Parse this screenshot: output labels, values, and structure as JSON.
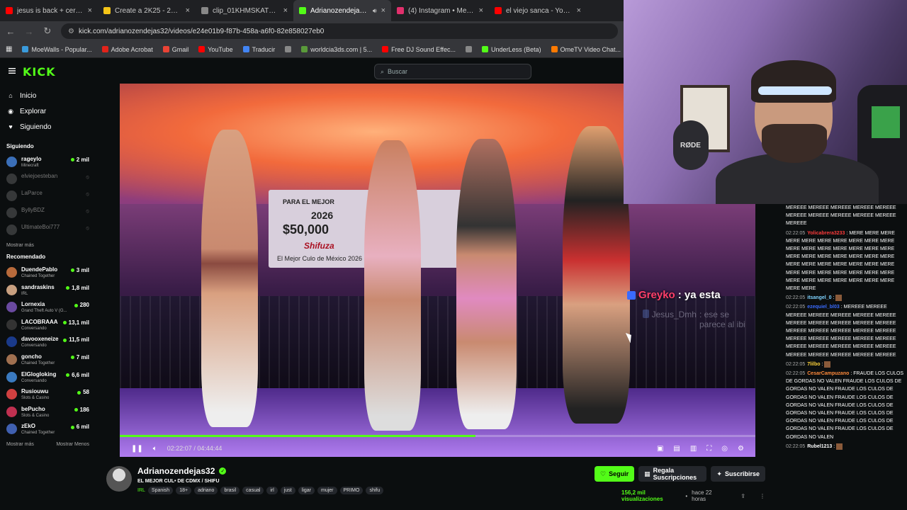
{
  "browser": {
    "tabs": [
      {
        "title": "jesus is back + cero - You",
        "color": "#ff0000",
        "active": false
      },
      {
        "title": "Create a 2K25 - 2K26 UD",
        "color": "#f5c518",
        "active": false
      },
      {
        "title": "clip_01KHMSKATMVBRN",
        "color": "#888888",
        "active": false
      },
      {
        "title": "Adrianozendejas32 - ",
        "color": "#53fc18",
        "active": true
      },
      {
        "title": "(4) Instagram • Mensajes",
        "color": "#e1306c",
        "active": false
      },
      {
        "title": "el viejo sanca - YouTube",
        "color": "#ff0000",
        "active": false
      }
    ],
    "url": "kick.com/adrianozendejas32/videos/e24e01b9-f87b-458a-a6f0-82e858027eb0",
    "bookmarks": [
      {
        "label": "MoeWalls - Popular...",
        "color": "#3a9bdc"
      },
      {
        "label": "Adobe Acrobat",
        "color": "#e2231a"
      },
      {
        "label": "Gmail",
        "color": "#ea4335"
      },
      {
        "label": "YouTube",
        "color": "#ff0000"
      },
      {
        "label": "Traducir",
        "color": "#4285f4"
      },
      {
        "label": "",
        "color": "#888888"
      },
      {
        "label": "worldcia3ds.com | 5...",
        "color": "#5a9a3a"
      },
      {
        "label": "Free DJ Sound Effec...",
        "color": "#ff0000"
      },
      {
        "label": "",
        "color": "#888888"
      },
      {
        "label": "UnderLess (Beta)",
        "color": "#53fc18"
      },
      {
        "label": "OmeTV Video Chat...",
        "color": "#ff7a00"
      }
    ]
  },
  "kick": {
    "logo": "KICK",
    "search_placeholder": "Buscar",
    "nav": [
      {
        "label": "Inicio",
        "icon": "home-icon",
        "glyph": "⌂"
      },
      {
        "label": "Explorar",
        "icon": "compass-icon",
        "glyph": "◉"
      },
      {
        "label": "Siguiendo",
        "icon": "heart-icon",
        "glyph": "♥"
      }
    ],
    "following_header": "Siguiendo",
    "following": [
      {
        "name": "rageylo",
        "category": "Minecraft",
        "viewers": "2 mil",
        "online": true,
        "color": "#3b6fb8"
      },
      {
        "name": "elviejoesteban",
        "category": "",
        "viewers": "",
        "online": false,
        "color": "#777777"
      },
      {
        "name": "LaParce",
        "category": "",
        "viewers": "",
        "online": false,
        "color": "#777777"
      },
      {
        "name": "ByllyBDZ",
        "category": "",
        "viewers": "",
        "online": false,
        "color": "#777777"
      },
      {
        "name": "UltimateBoi777",
        "category": "",
        "viewers": "",
        "online": false,
        "color": "#777777"
      }
    ],
    "show_more": "Mostrar más",
    "recommended_header": "Recomendado",
    "recommended": [
      {
        "name": "DuendePablo",
        "category": "Chained Together",
        "viewers": "3 mil",
        "color": "#b86a3b"
      },
      {
        "name": "sandraskins",
        "category": "IRL",
        "viewers": "1,8 mil",
        "color": "#c8a080"
      },
      {
        "name": "Lornexia",
        "category": "Grand Theft Auto V (G...",
        "viewers": "280",
        "color": "#6a4aa0"
      },
      {
        "name": "LACOBRAAA",
        "category": "Conversando",
        "viewers": "13,1 mil",
        "color": "#333333"
      },
      {
        "name": "davooxeneize",
        "category": "Conversando",
        "viewers": "11,5 mil",
        "color": "#1a3a8a"
      },
      {
        "name": "goncho",
        "category": "Chained Together",
        "viewers": "7 mil",
        "color": "#a07050"
      },
      {
        "name": "ElGlogloking",
        "category": "Conversando",
        "viewers": "6,6 mil",
        "color": "#3a7ac0"
      },
      {
        "name": "Rusiouwu",
        "category": "Slots & Casino",
        "viewers": "58",
        "color": "#d04040"
      },
      {
        "name": "bePucho",
        "category": "Slots & Casino",
        "viewers": "186",
        "color": "#c03050"
      },
      {
        "name": "zEkO",
        "category": "Chained Together",
        "viewers": "6 mil",
        "color": "#4060b0"
      }
    ],
    "footer_more": "Mostrar más",
    "footer_less": "Mostrar Menos"
  },
  "video": {
    "banner": {
      "line1": "PARA EL MEJOR",
      "line2": "2026",
      "line3": "$50,000",
      "line4": "Shifuza",
      "line5": "El Mejor Culo de México 2026"
    },
    "overlay_chat": [
      {
        "user": "Greyko",
        "text": ": ya esta"
      },
      {
        "user": "Jesus_Dmh",
        "text": ": ese se parece al ibi"
      }
    ],
    "time_current": "02:22:07",
    "time_sep": " / ",
    "time_total": "04:44:44",
    "progress_fraction": 0.56
  },
  "channel": {
    "name": "Adrianozendejas32",
    "title": "EL MEJOR CUL• DE CDMX  / SHIFU",
    "category": "IRL",
    "tags": [
      "Spanish",
      "18+",
      "adriano",
      "brasil",
      "casual",
      "irl",
      "just",
      "ligar",
      "mujer",
      "PRIMO",
      "shifu"
    ],
    "follow": "Seguir",
    "gift": "Regala Suscripciones",
    "subscribe": "Suscribirse",
    "views": "156,2 mil visualizaciones",
    "ago": "hace 22 horas"
  },
  "chat": [
    {
      "ts": "",
      "user": "",
      "ucolor": "#ffffff",
      "text": "MEREEE MEREEE MEREEE MEREEE MEREEE MEREEE MEREEE MEREEE MEREEE MEREEE MEREEE"
    },
    {
      "ts": "02:22:05",
      "user": "Yolicabrera3233",
      "ucolor": "#ff3b3b",
      "text": ": MERE MERE MERE MERE MERE MERE MERE MERE MERE MERE MERE MERE MERE MERE MERE MERE MERE MERE MERE MERE MERE MERE MERE MERE MERE MERE MERE MERE MERE MERE MERE MERE MERE MERE MERE MERE MERE MERE MERE MERE MERE MERE MERE MERE MERE MERE MERE"
    },
    {
      "ts": "02:22:05",
      "user": "itsangel_0",
      "ucolor": "#7fd3ff",
      "text": ":"
    },
    {
      "ts": "02:22:05",
      "user": "ezequiel_bl03",
      "ucolor": "#3a6bff",
      "text": ": MEREEE MEREEE MEREEE MEREEE MEREEE MEREEE MEREEE MEREEE MEREEE MEREEE MEREEE MEREEE MEREEE MEREEE MEREEE MEREEE MEREEE MEREEE MEREEE MEREEE MEREEE MEREEE MEREEE MEREEE MEREEE MEREEE MEREEE MEREEE MEREEE MEREEE MEREEE MEREEE"
    },
    {
      "ts": "02:22:05",
      "user": "7lilbo",
      "ucolor": "#ffd43b",
      "text": ":"
    },
    {
      "ts": "02:22:05",
      "user": "CesarCampuzano",
      "ucolor": "#ff8a3b",
      "text": ": FRAUDE LOS CULOS DE GORDAS NO VALEN FRAUDE LOS CULOS DE GORDAS NO VALEN FRAUDE LOS CULOS DE GORDAS NO VALEN FRAUDE LOS CULOS DE GORDAS NO VALEN FRAUDE LOS CULOS DE GORDAS NO VALEN FRAUDE LOS CULOS DE GORDAS NO VALEN FRAUDE LOS CULOS DE GORDAS NO VALEN FRAUDE LOS CULOS DE GORDAS NO VALEN"
    },
    {
      "ts": "02:22:05",
      "user": "Rubel1213",
      "ucolor": "#ffffff",
      "text": ":"
    }
  ]
}
